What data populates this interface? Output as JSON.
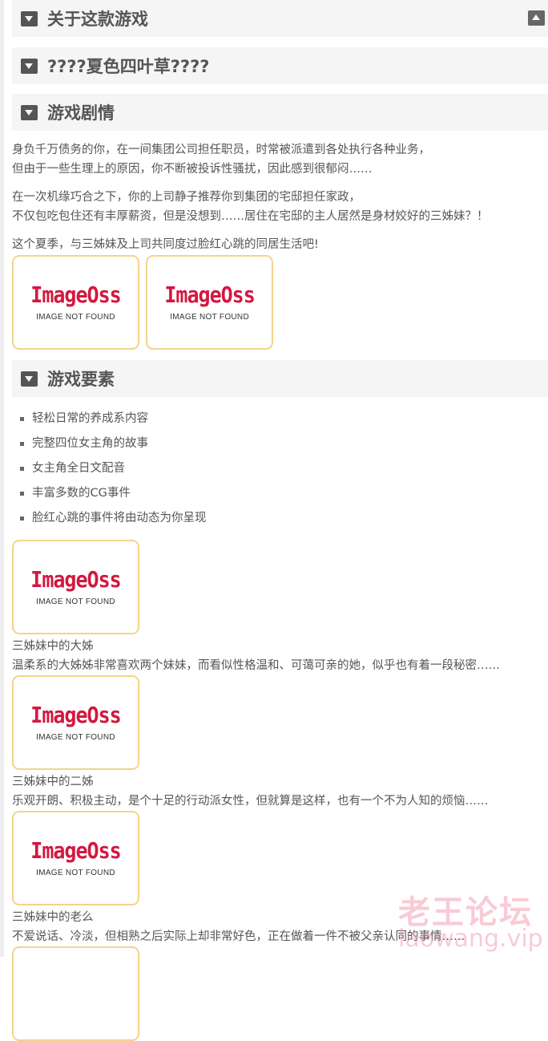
{
  "sections": [
    {
      "title": "关于这款游戏"
    },
    {
      "title": "????夏色四叶草????"
    },
    {
      "title": "游戏剧情"
    },
    {
      "title": "游戏要素"
    }
  ],
  "story": {
    "p1": [
      "身负千万债务的你，在一间集团公司担任职员，时常被派遣到各处执行各种业务，",
      "但由于一些生理上的原因，你不断被投诉性骚扰，因此感到很郁闷……"
    ],
    "p2": [
      "在一次机缘巧合之下，你的上司静子推荐你到集团的宅邸担任家政，",
      "不仅包吃包住还有丰厚薪资，但是没想到……居住在宅邸的主人居然是身材姣好的三姊妹？！"
    ],
    "p3": "这个夏季，与三姊妹及上司共同度过脸红心跳的同居生活吧!"
  },
  "placeholder": {
    "logo": "ImageOss",
    "text": "IMAGE NOT FOUND"
  },
  "features": [
    "轻松日常的养成系内容",
    "完整四位女主角的故事",
    "女主角全日文配音",
    "丰富多数的CG事件",
    "脸红心跳的事件将由动态为你呈现"
  ],
  "characters": [
    {
      "name": "三姊妹中的大姊",
      "desc": "温柔系的大姊姊非常喜欢两个妹妹，而看似性格温和、可蔼可亲的她，似乎也有着一段秘密……"
    },
    {
      "name": "三姊妹中的二姊",
      "desc": "乐观开朗、积极主动，是个十足的行动派女性，但就算是这样，也有一个不为人知的烦恼……"
    },
    {
      "name": "三姊妹中的老么",
      "desc": "不爱说话、冷淡，但相熟之后实际上却非常好色，正在做着一件不被父亲认同的事情……"
    }
  ],
  "watermark": {
    "line1": "老王论坛",
    "line2": "laowang.vip"
  },
  "colors": {
    "header_bg": "#f5f5f5",
    "text": "#555555",
    "image_border": "#f2d48a",
    "logo": "#d2183f"
  }
}
